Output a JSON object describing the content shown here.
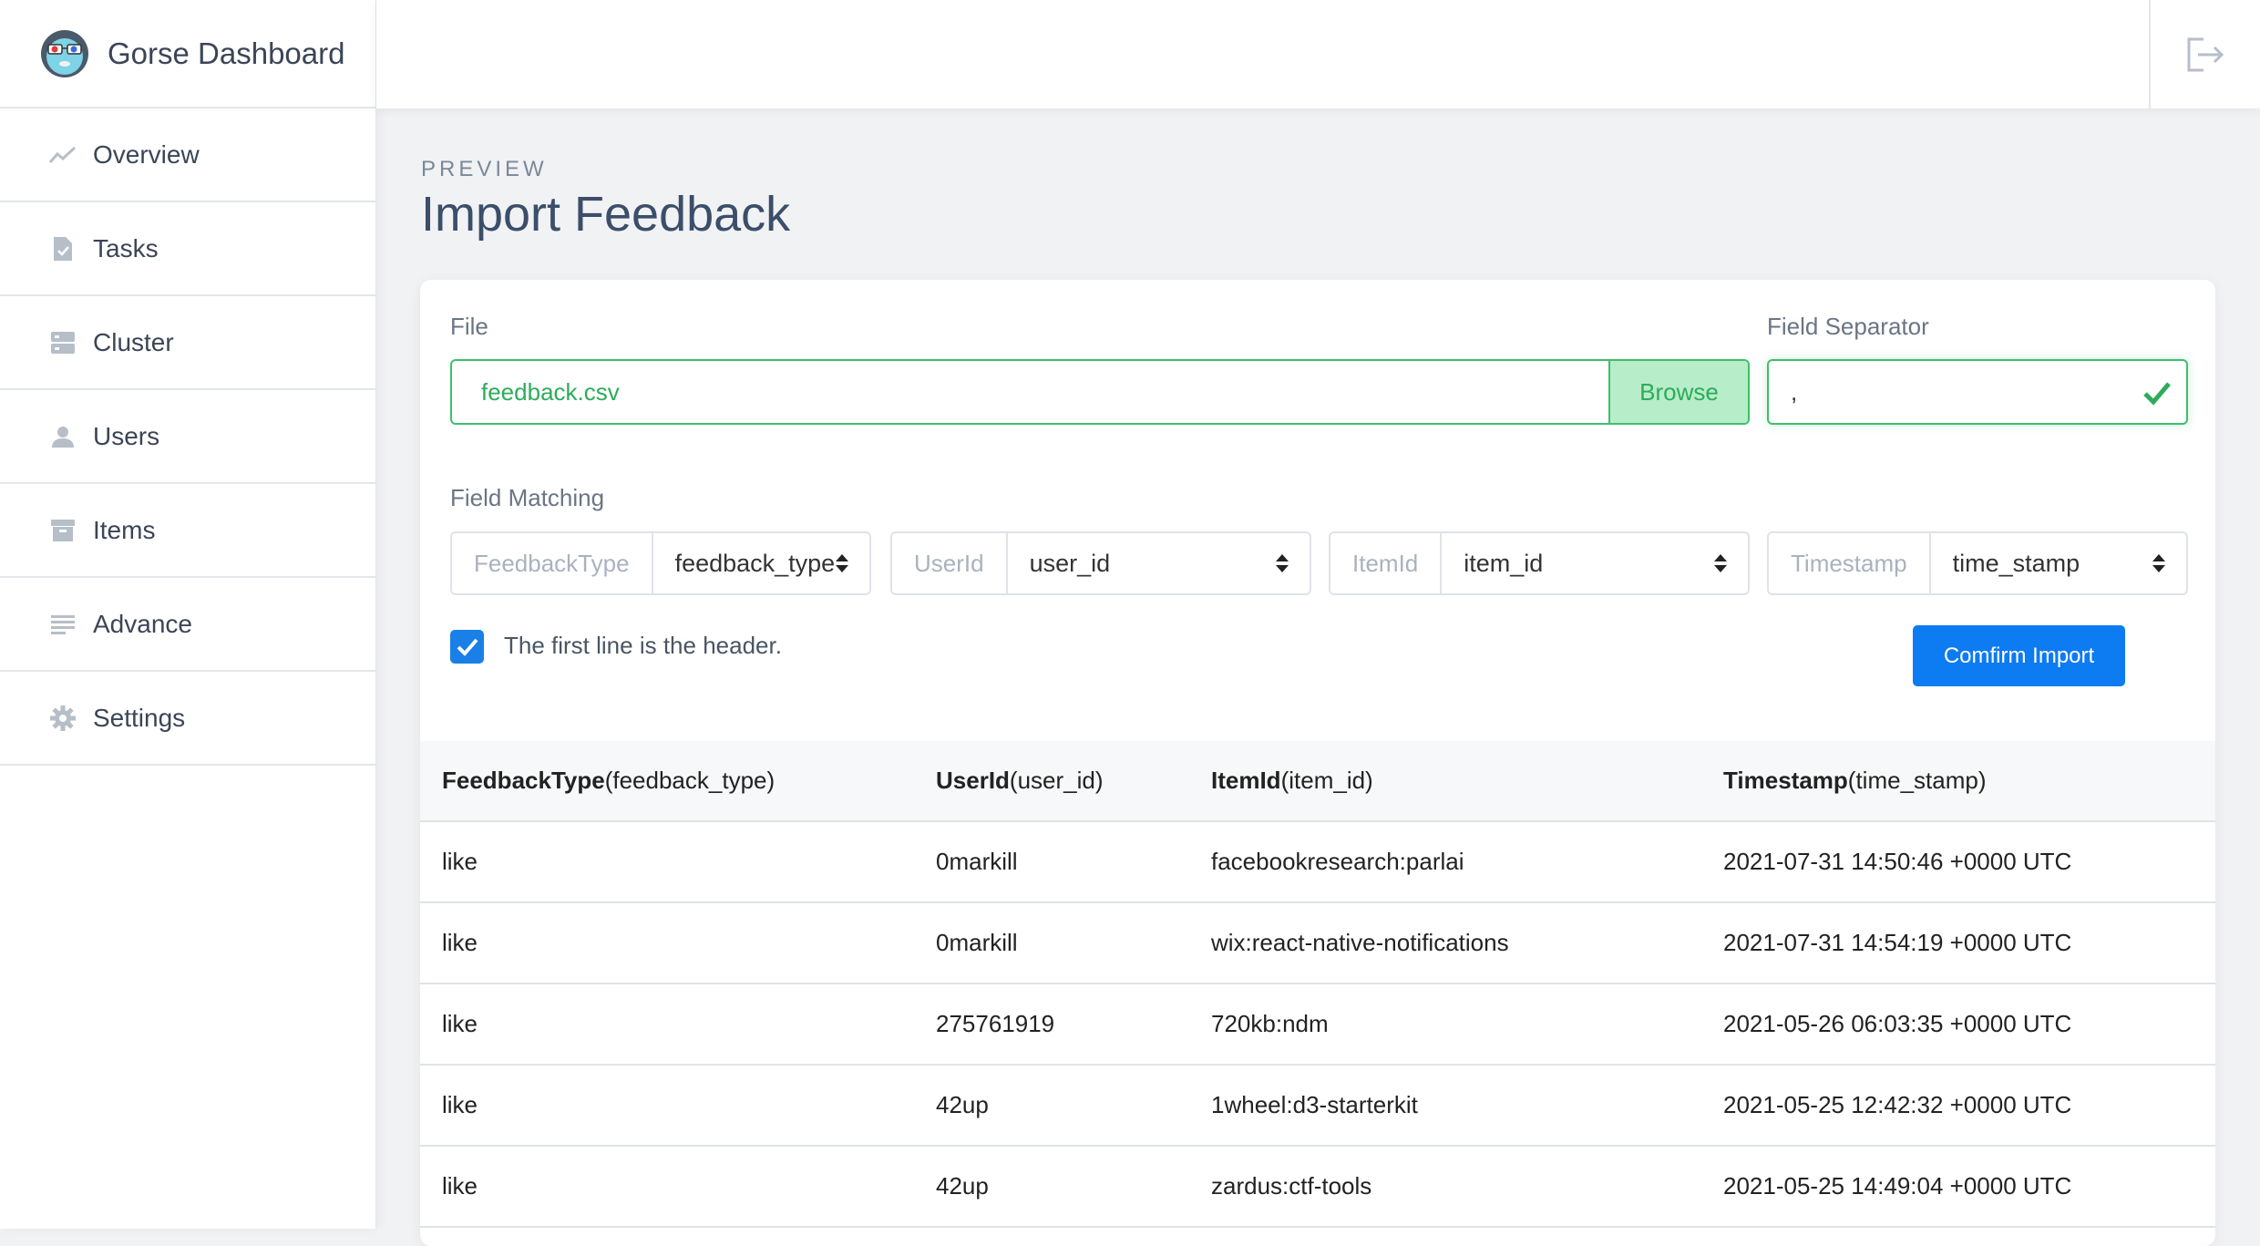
{
  "brand": {
    "name": "Gorse Dashboard"
  },
  "sidebar": {
    "items": [
      {
        "label": "Overview",
        "icon": "chart-line-icon"
      },
      {
        "label": "Tasks",
        "icon": "file-check-icon"
      },
      {
        "label": "Cluster",
        "icon": "server-icon"
      },
      {
        "label": "Users",
        "icon": "user-icon"
      },
      {
        "label": "Items",
        "icon": "archive-icon"
      },
      {
        "label": "Advance",
        "icon": "lines-icon"
      },
      {
        "label": "Settings",
        "icon": "gear-icon"
      }
    ]
  },
  "header": {
    "subheading": "PREVIEW",
    "title": "Import Feedback"
  },
  "form": {
    "file_label": "File",
    "file_name": "feedback.csv",
    "browse_label": "Browse",
    "separator_label": "Field Separator",
    "separator_value": ",",
    "matching_label": "Field Matching",
    "fields": [
      {
        "prefix": "FeedbackType",
        "value": "feedback_type"
      },
      {
        "prefix": "UserId",
        "value": "user_id"
      },
      {
        "prefix": "ItemId",
        "value": "item_id"
      },
      {
        "prefix": "Timestamp",
        "value": "time_stamp"
      }
    ],
    "header_checkbox_label": "The first line is the header.",
    "header_checked": true,
    "confirm_label": "Comfirm Import"
  },
  "table": {
    "columns": [
      {
        "name": "FeedbackType",
        "field": "(feedback_type)"
      },
      {
        "name": "UserId",
        "field": "(user_id)"
      },
      {
        "name": "ItemId",
        "field": "(item_id)"
      },
      {
        "name": "Timestamp",
        "field": "(time_stamp)"
      }
    ],
    "rows": [
      [
        "like",
        "0markill",
        "facebookresearch:parlai",
        "2021-07-31 14:50:46 +0000 UTC"
      ],
      [
        "like",
        "0markill",
        "wix:react-native-notifications",
        "2021-07-31 14:54:19 +0000 UTC"
      ],
      [
        "like",
        "275761919",
        "720kb:ndm",
        "2021-05-26 06:03:35 +0000 UTC"
      ],
      [
        "like",
        "42up",
        "1wheel:d3-starterkit",
        "2021-05-25 12:42:32 +0000 UTC"
      ],
      [
        "like",
        "42up",
        "zardus:ctf-tools",
        "2021-05-25 14:49:04 +0000 UTC"
      ]
    ]
  },
  "colors": {
    "success": "#3dbf6a",
    "primary": "#0d7bf2",
    "checkbox": "#1a7fe6"
  }
}
